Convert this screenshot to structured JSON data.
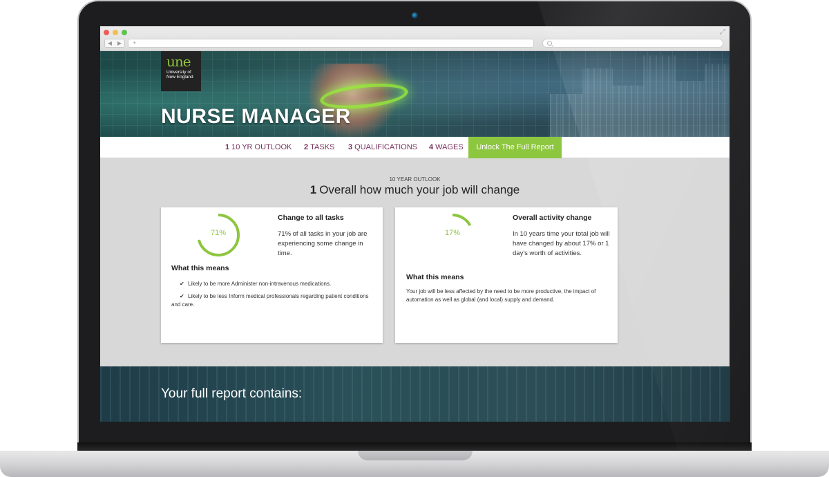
{
  "browser": {
    "address": "+",
    "back_icon": "◀",
    "forward_icon": "▶",
    "expand_icon": "⤢"
  },
  "hero": {
    "logo_mark": "une",
    "logo_line1": "University of",
    "logo_line2": "New England",
    "title": "NURSE MANAGER"
  },
  "nav": {
    "items": [
      {
        "num": "1",
        "label": "10 YR OUTLOOK"
      },
      {
        "num": "2",
        "label": "TASKS"
      },
      {
        "num": "3",
        "label": "QUALIFICATIONS"
      },
      {
        "num": "4",
        "label": "WAGES"
      }
    ],
    "cta": "Unlock The Full Report"
  },
  "main": {
    "kicker": "10 YEAR OUTLOOK",
    "title_num": "1",
    "title": "Overall how much your job will change",
    "cards": [
      {
        "value": "71%",
        "fraction": 0.71,
        "heading": "Change to all tasks",
        "body": "71% of all tasks in your job are experiencing some change in time.",
        "means_heading": "What this means",
        "bullets": [
          "Likely to be more Administer non-intravenous medications.",
          "Likely to be less Inform medical professionals regarding patient conditions and care."
        ]
      },
      {
        "value": "17%",
        "fraction": 0.17,
        "heading": "Overall activity change",
        "body": "In 10 years time your total job will have changed by about 17% or 1 day's worth of activities.",
        "means_heading": "What this means",
        "means_body": "Your job will be less affected by the need to be more productive, the impact of automation as well as global (and local) supply and demand."
      }
    ]
  },
  "banner": {
    "title": "Your full report contains:"
  },
  "colors": {
    "accent": "#8dc63f",
    "nav_text": "#77305f",
    "hero_dark": "#1d4a49"
  },
  "icons": {
    "check": "✔"
  }
}
